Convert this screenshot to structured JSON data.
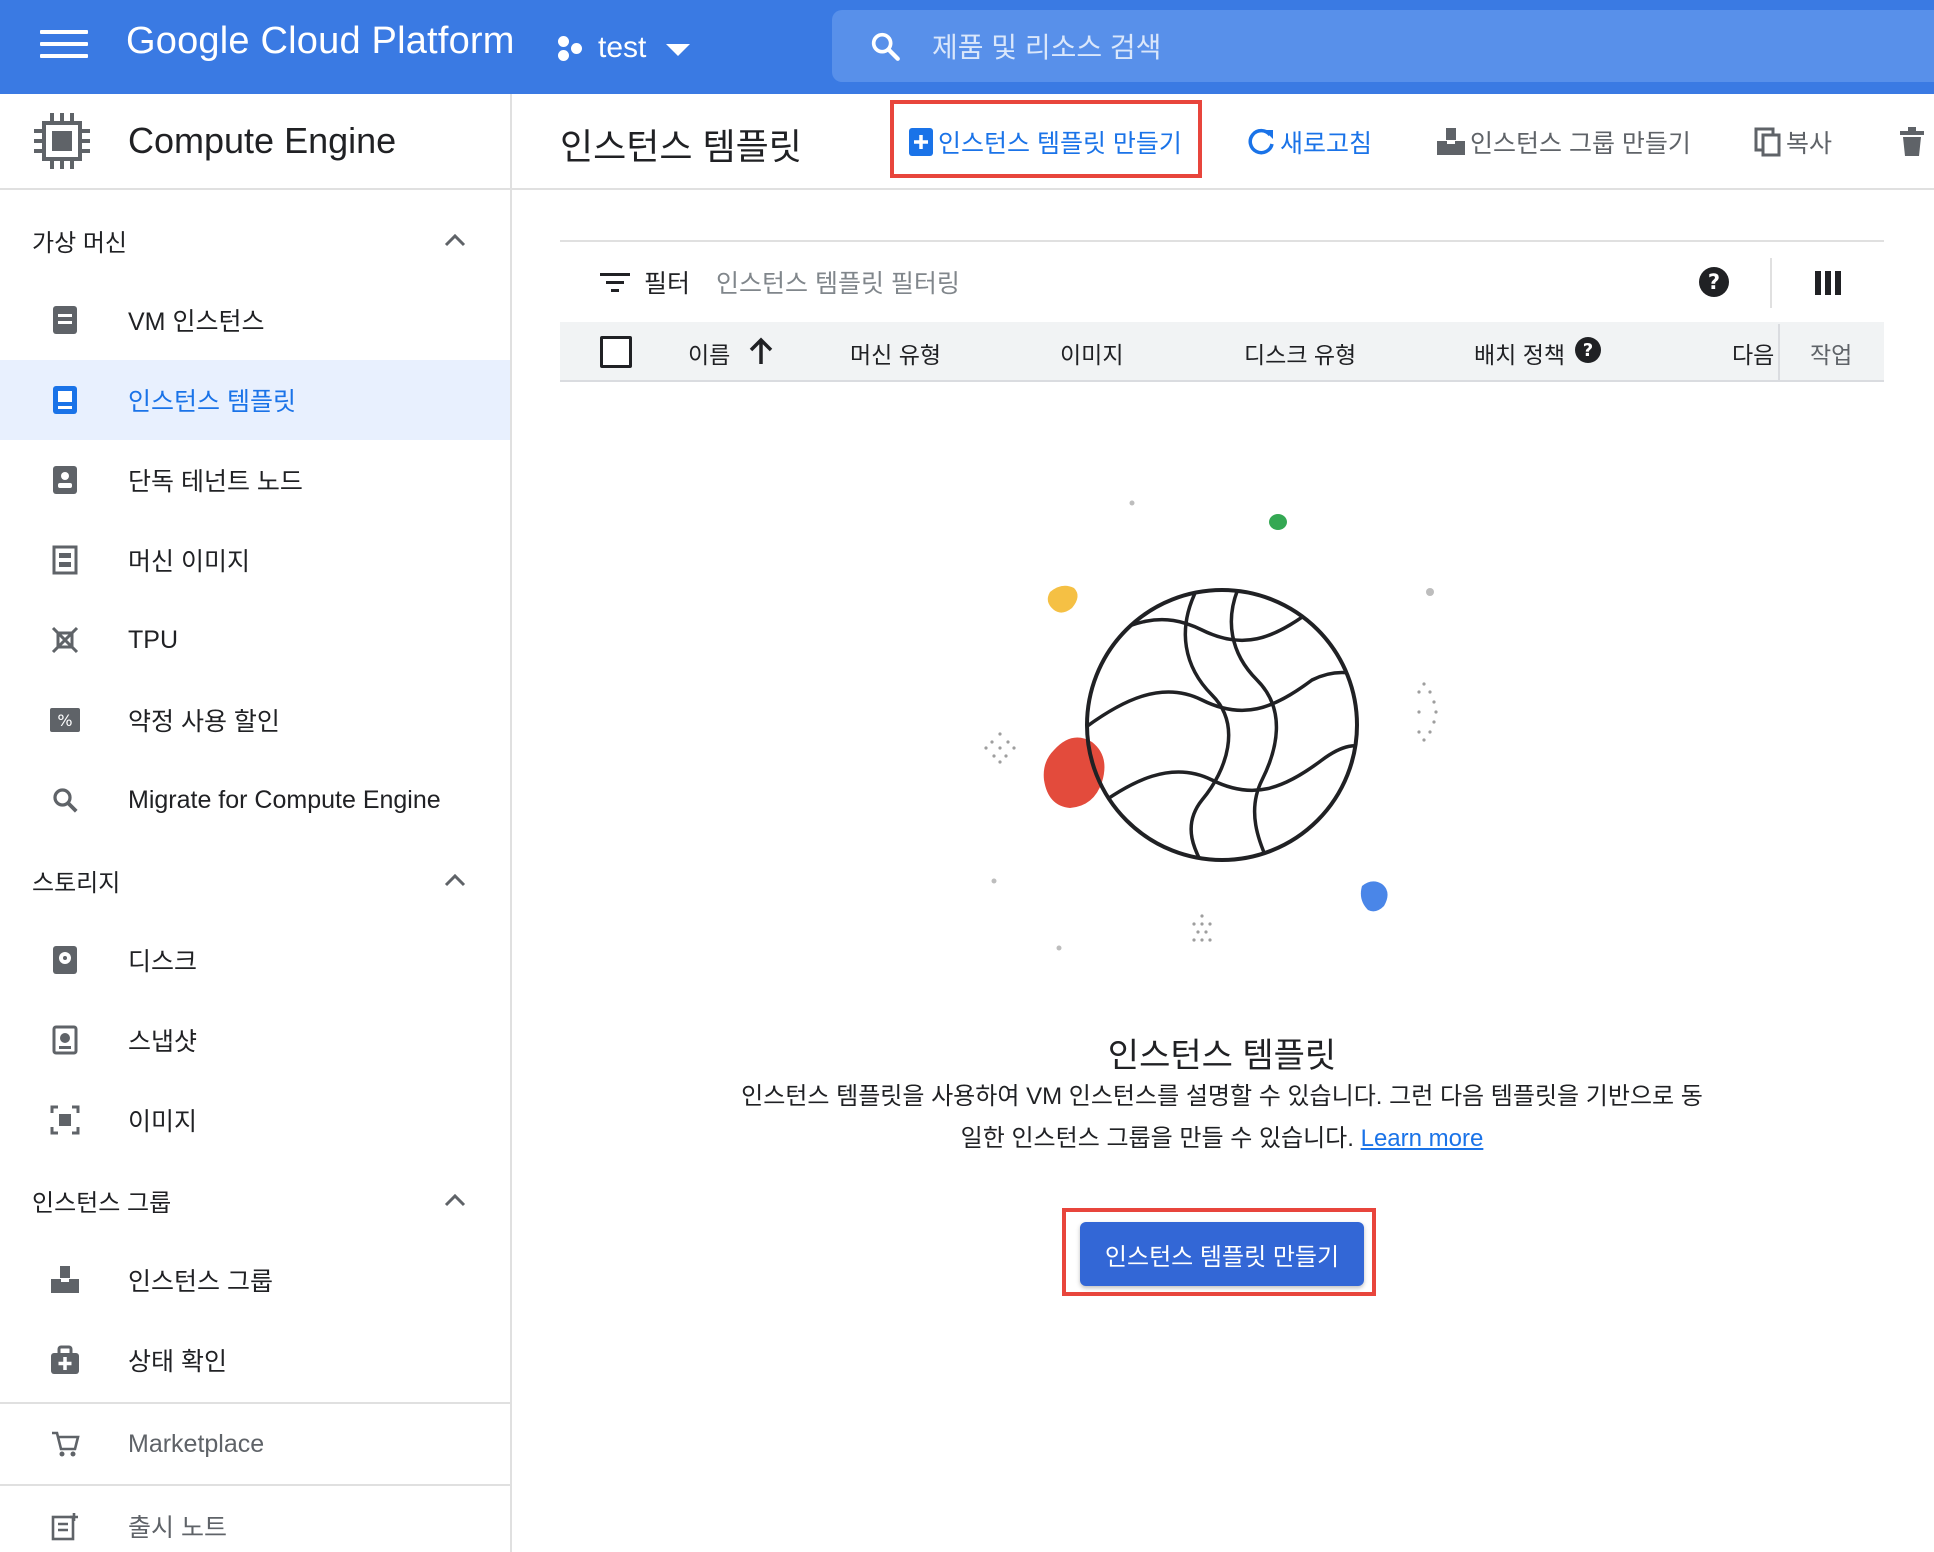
{
  "topbar": {
    "brand": "Google Cloud Platform",
    "project": "test",
    "search_placeholder": "제품 및 리소스 검색"
  },
  "sidebar": {
    "product": "Compute Engine",
    "sections": {
      "vm": "가상 머신",
      "storage": "스토리지",
      "instance_groups": "인스턴스 그룹"
    },
    "items": [
      {
        "label": "VM 인스턴스",
        "icon": "vm-instances-icon"
      },
      {
        "label": "인스턴스 템플릿",
        "icon": "instance-templates-icon",
        "active": true
      },
      {
        "label": "단독 테넌트 노드",
        "icon": "sole-tenant-nodes-icon"
      },
      {
        "label": "머신 이미지",
        "icon": "machine-images-icon"
      },
      {
        "label": "TPU",
        "icon": "tpu-icon"
      },
      {
        "label": "약정 사용 할인",
        "icon": "committed-use-discount-icon"
      },
      {
        "label": "Migrate for Compute Engine",
        "icon": "search-icon"
      },
      {
        "label": "디스크",
        "icon": "disk-icon"
      },
      {
        "label": "스냅샷",
        "icon": "snapshot-icon"
      },
      {
        "label": "이미지",
        "icon": "images-icon"
      },
      {
        "label": "인스턴스 그룹",
        "icon": "instance-groups-icon"
      },
      {
        "label": "상태 확인",
        "icon": "health-check-icon"
      }
    ],
    "marketplace": "Marketplace",
    "release_notes": "출시 노트"
  },
  "header": {
    "title": "인스턴스 템플릿",
    "create_template": "인스턴스 템플릿 만들기",
    "refresh": "새로고침",
    "create_group": "인스턴스 그룹 만들기",
    "copy": "복사"
  },
  "filter": {
    "label": "필터",
    "placeholder": "인스턴스 템플릿 필터링"
  },
  "table": {
    "columns": [
      "이름",
      "머신 유형",
      "이미지",
      "디스크 유형",
      "배치 정책",
      "다음",
      "작업"
    ]
  },
  "empty_state": {
    "title": "인스턴스 템플릿",
    "description": "인스턴스 템플릿을 사용하여 VM 인스턴스를 설명할 수 있습니다. 그런 다음 템플릿을 기반으로 동일한 인스턴스 그룹을 만들 수 있습니다.",
    "learn_more": "Learn more",
    "button": "인스턴스 템플릿 만들기"
  },
  "colors": {
    "topbar": "#3a7ae3",
    "accent": "#1a73e8",
    "primary_button": "#3367d6",
    "highlight": "#e8453c"
  }
}
